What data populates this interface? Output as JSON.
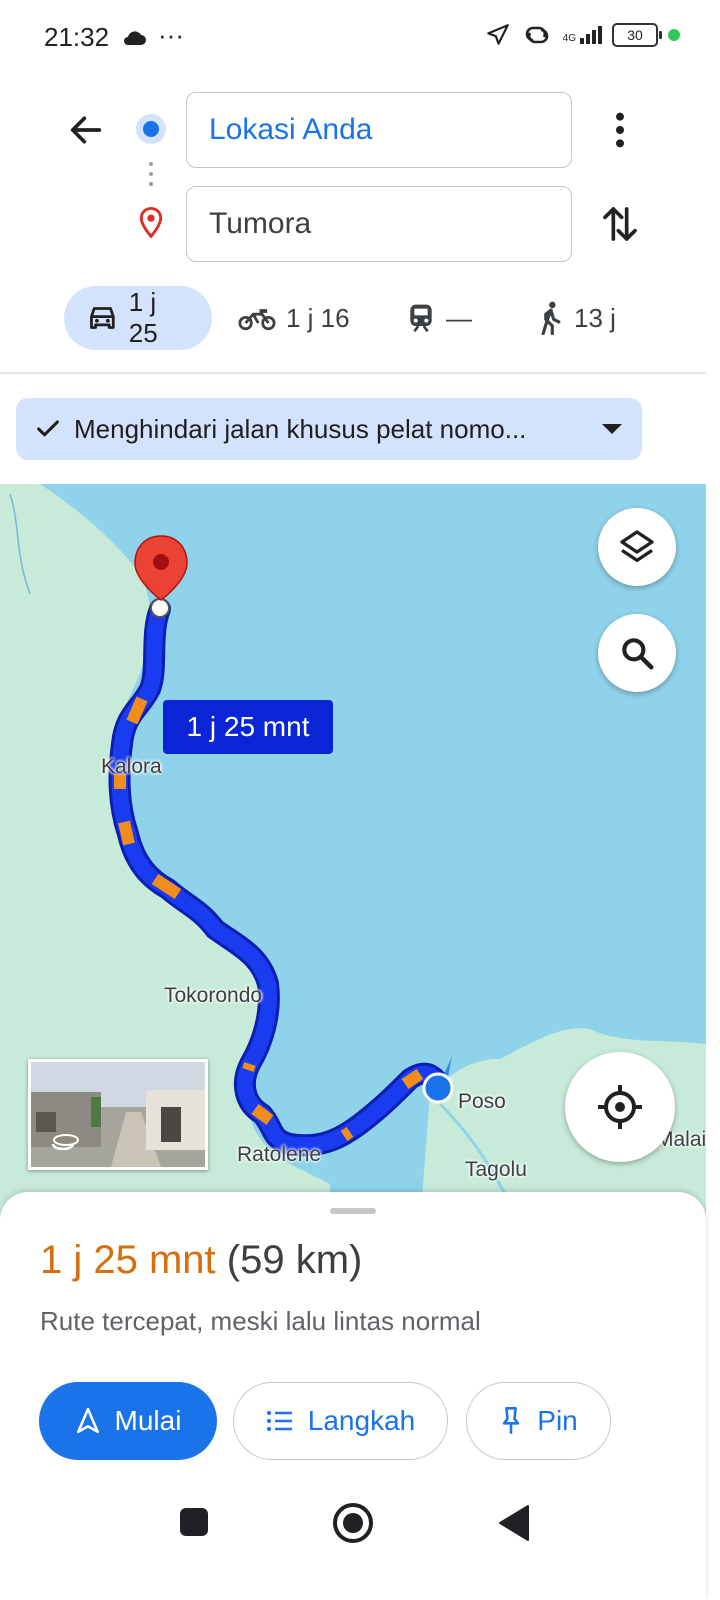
{
  "status_bar": {
    "time": "21:32",
    "dots": "···",
    "network": "4G",
    "battery": "30"
  },
  "search": {
    "origin": "Lokasi Anda",
    "destination": "Tumora"
  },
  "modes": [
    {
      "icon": "car-icon",
      "label": "1 j 25"
    },
    {
      "icon": "motorcycle-icon",
      "label": "1 j 16"
    },
    {
      "icon": "train-icon",
      "label": "—"
    },
    {
      "icon": "walk-icon",
      "label": "13 j"
    }
  ],
  "options_chip": {
    "label": "Menghindari jalan khusus pelat nomo..."
  },
  "map": {
    "route_label": "1 j 25 mnt",
    "places": [
      "Kalora",
      "Tokorondo",
      "Ratolene",
      "Poso",
      "Tagolu",
      "Malai"
    ]
  },
  "sheet": {
    "eta_time": "1 j 25 mnt",
    "eta_distance": "(59 km)",
    "description": "Rute tercepat, meski lalu lintas normal",
    "buttons": {
      "start": "Mulai",
      "steps": "Langkah",
      "pin": "Pin"
    }
  },
  "colors": {
    "accent": "#1a73e8",
    "route": "#1a3cf0",
    "traffic": "#f28c1a",
    "eta": "#d56e0c",
    "chip": "#d3e3fd"
  }
}
